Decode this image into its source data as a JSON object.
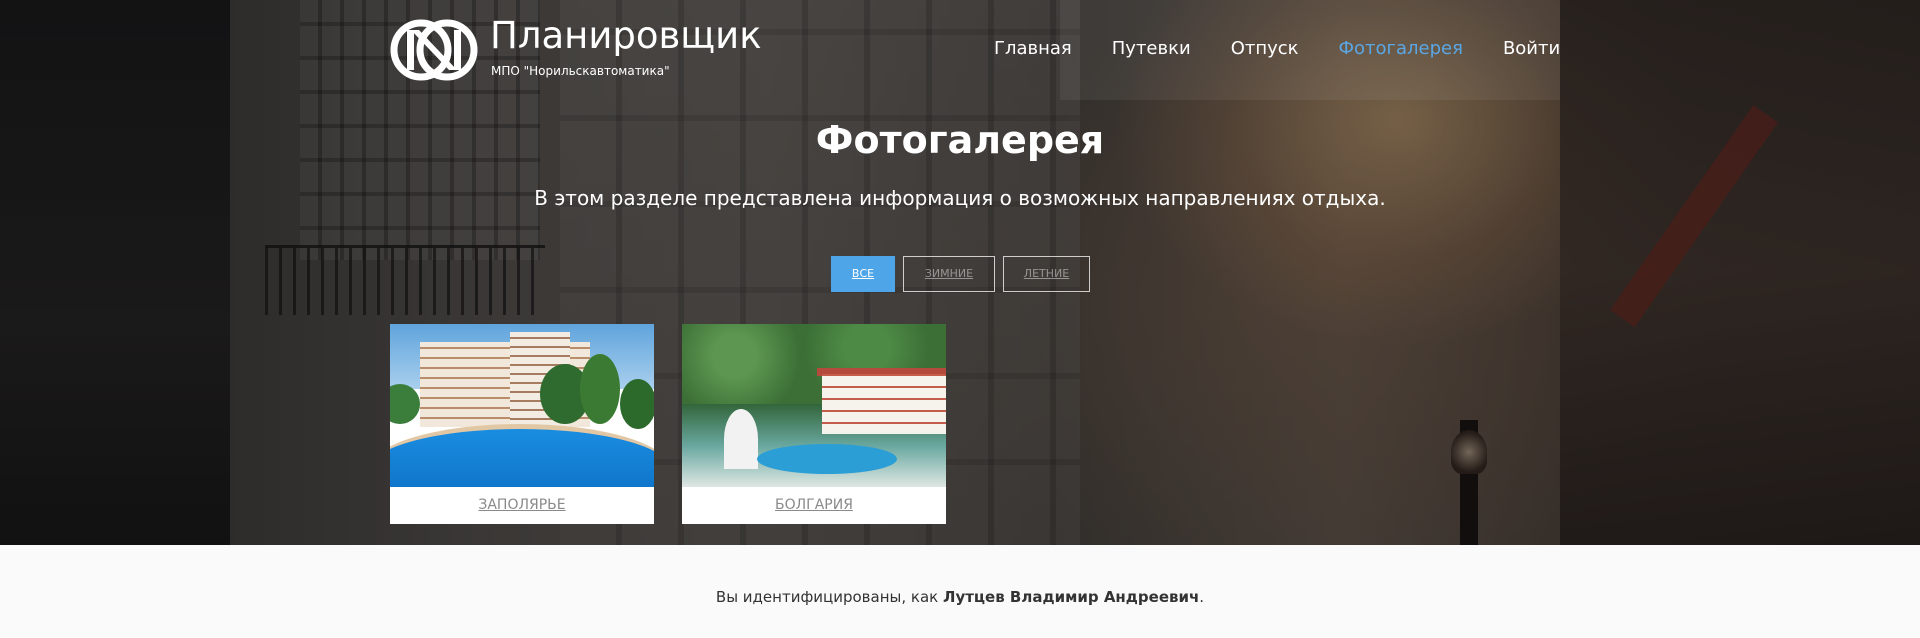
{
  "brand": {
    "title": "Планировщик",
    "subtitle": "МПО \"Норильскавтоматика\""
  },
  "nav": {
    "items": [
      {
        "label": "Главная",
        "active": false
      },
      {
        "label": "Путевки",
        "active": false
      },
      {
        "label": "Отпуск",
        "active": false
      },
      {
        "label": "Фотогалерея",
        "active": true
      },
      {
        "label": "Войти",
        "active": false
      }
    ]
  },
  "page": {
    "title": "Фотогалерея",
    "description": "В этом разделе представлена информация о возможных направлениях отдыха."
  },
  "filters": [
    {
      "label": "Все",
      "active": true
    },
    {
      "label": "Зимние",
      "active": false
    },
    {
      "label": "Летние",
      "active": false
    }
  ],
  "gallery": [
    {
      "caption": "Заполярье"
    },
    {
      "caption": "Болгария"
    }
  ],
  "footer": {
    "prefix": "Вы идентифицированы, как ",
    "user": "Лутцев Владимир Андреевич",
    "suffix": "."
  },
  "colors": {
    "accent": "#4ea6e8",
    "nav_active": "#5aa7e6"
  }
}
